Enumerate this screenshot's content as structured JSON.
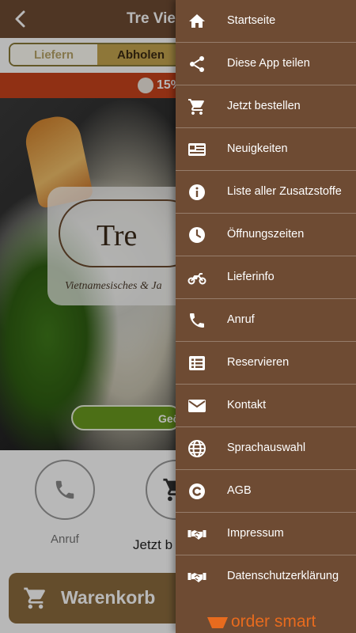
{
  "app": {
    "title": "Tre Viet",
    "toggle": {
      "deliver": "Liefern",
      "pickup": "Abholen"
    },
    "promo": {
      "percent": "15%"
    },
    "logo": {
      "text": "Tre",
      "subtitle": "Vietnamesisches & Ja"
    },
    "open_pill": "Geö",
    "actions": {
      "call_label": "Anruf",
      "order_label": "Jetzt b"
    },
    "cart_button": "Warenkorb"
  },
  "drawer": {
    "items": [
      {
        "label": "Startseite",
        "icon": "home-icon"
      },
      {
        "label": "Diese App teilen",
        "icon": "share-icon"
      },
      {
        "label": "Jetzt bestellen",
        "icon": "cart-icon"
      },
      {
        "label": "Neuigkeiten",
        "icon": "news-icon"
      },
      {
        "label": "Liste aller Zusatzstoffe",
        "icon": "info-icon"
      },
      {
        "label": "Öffnungszeiten",
        "icon": "clock-icon"
      },
      {
        "label": "Lieferinfo",
        "icon": "motorcycle-icon"
      },
      {
        "label": "Anruf",
        "icon": "phone-icon"
      },
      {
        "label": "Reservieren",
        "icon": "list-icon"
      },
      {
        "label": "Kontakt",
        "icon": "mail-icon"
      },
      {
        "label": "Sprachauswahl",
        "icon": "globe-icon"
      },
      {
        "label": "AGB",
        "icon": "copyright-icon"
      },
      {
        "label": "Impressum",
        "icon": "handshake-icon"
      },
      {
        "label": "Datenschutzerklärung",
        "icon": "handshake-icon"
      }
    ],
    "footer_brand": "order smart"
  },
  "colors": {
    "drawer_bg": "#6e4b33",
    "promo_bg": "#c8431d",
    "cart_bg": "#8b6b3e",
    "brand_orange": "#e86b1e"
  }
}
